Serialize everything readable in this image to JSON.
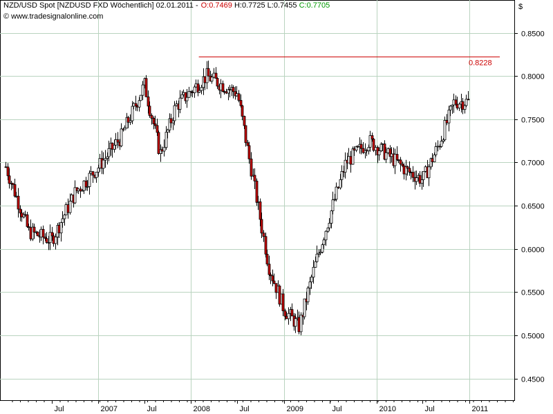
{
  "header": {
    "symbol": "NZD/USD Spot [NZDUSD FXD  Wöchentlich] 02.01.2011 -",
    "open": "O:0.7469",
    "high": "H:0.7725",
    "low": "L:0.7455",
    "close": "C:0.7705",
    "source": "© www.tradesignalonline.com",
    "currency": "$"
  },
  "colors": {
    "grid": "#b9d3bf",
    "down": "#cc0000",
    "up": "#ffffff",
    "wick": "#000000",
    "level": "#cc0000"
  },
  "chart_data": {
    "type": "candlestick",
    "yaxis": {
      "ticks": [
        "0.4500",
        "0.5000",
        "0.5500",
        "0.6000",
        "0.6500",
        "0.7000",
        "0.7500",
        "0.8000",
        "0.8500"
      ],
      "ylim": [
        0.425,
        0.88
      ],
      "side": "right"
    },
    "xaxis": {
      "labels": [
        "Jul",
        "2007",
        "Jul",
        "2008",
        "Jul",
        "2009",
        "Jul",
        "2010",
        "Jul",
        "2011"
      ]
    },
    "level": {
      "value": 0.8228,
      "label": "0.8228"
    },
    "series": [
      {
        "x": [
          "2006-01-01",
          "2006-04-01",
          "2006-07-01",
          "2006-10-01",
          "2007-01-01",
          "2007-04-01",
          "2007-07-01",
          "2007-09-01",
          "2007-11-01",
          "2008-03-01",
          "2008-07-01",
          "2008-09-01",
          "2008-11-01",
          "2009-01-01",
          "2009-03-01",
          "2009-05-01",
          "2009-07-01",
          "2009-09-01",
          "2009-12-01",
          "2010-03-01",
          "2010-05-01",
          "2010-07-01",
          "2010-09-01",
          "2010-11-01",
          "2011-01-01"
        ],
        "values": [
          0.695,
          0.62,
          0.61,
          0.665,
          0.695,
          0.73,
          0.79,
          0.71,
          0.765,
          0.8,
          0.78,
          0.68,
          0.58,
          0.53,
          0.51,
          0.58,
          0.64,
          0.7,
          0.725,
          0.705,
          0.69,
          0.68,
          0.72,
          0.77,
          0.7705
        ]
      }
    ]
  }
}
